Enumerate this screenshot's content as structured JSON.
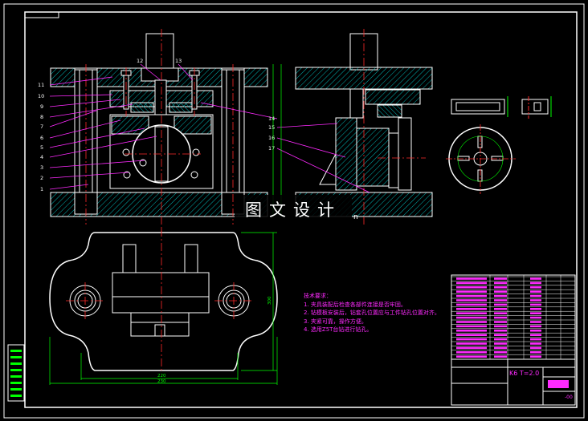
{
  "drawing": {
    "watermark_text": "图文设计",
    "watermark_suffix": "n",
    "title_block_text": "K6 T=2.0",
    "drawing_number": "-00",
    "balloons_left": [
      "11",
      "10",
      "9",
      "8",
      "7",
      "6",
      "5",
      "4",
      "3",
      "2",
      "1"
    ],
    "balloons_right": [
      "14",
      "15",
      "16",
      "17"
    ],
    "balloons_top": [
      "12",
      "13"
    ],
    "dims_bottom": [
      "220",
      "230"
    ],
    "dim_right": "300",
    "technical_requirements": {
      "heading": "技术要求：",
      "items": [
        "1.  夹具装配后检查各部件连接是否牢固。",
        "2.  钻模板安装后，钻套孔位置应与工件钻孔位置对齐。",
        "3.  夹紧可靠，操作方便。",
        "4.  选用Z5T台钻进行钻孔。"
      ]
    },
    "colors": {
      "background": "#000000",
      "outline": "#ffffff",
      "centerline": "#ff2a2a",
      "leader": "#ff2aff",
      "dimension": "#00ff00",
      "hatch": "#00c8c8"
    }
  }
}
